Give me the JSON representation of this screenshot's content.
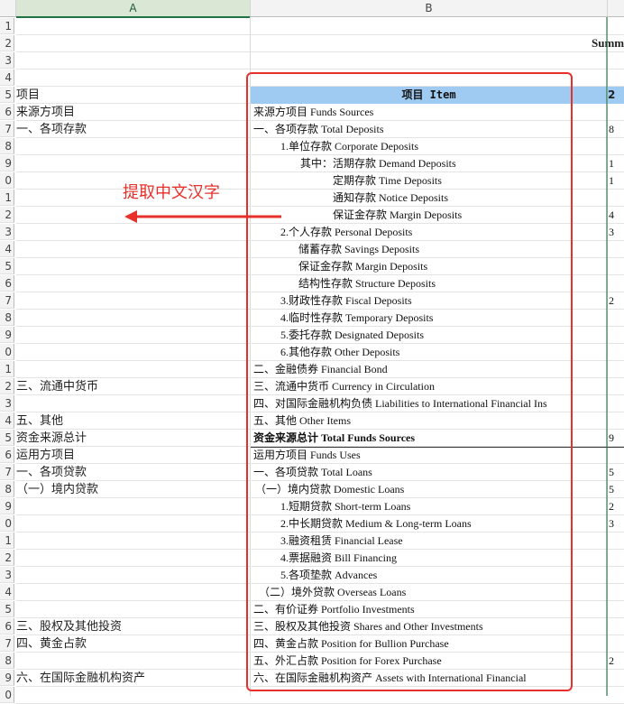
{
  "columns": {
    "a": "A",
    "b": "B"
  },
  "row_numbers": [
    "1",
    "2",
    "3",
    "4",
    "5",
    "6",
    "7",
    "8",
    "9",
    "0",
    "1",
    "2",
    "3",
    "4",
    "5",
    "6",
    "7",
    "8",
    "9",
    "0",
    "1",
    "2",
    "3",
    "4",
    "5",
    "6",
    "7",
    "8",
    "9",
    "0",
    "1",
    "2",
    "3",
    "4",
    "5",
    "6",
    "7",
    "8",
    "9",
    "0"
  ],
  "summary_label": "Summ",
  "annotation": "提取中文汉字",
  "header_row": {
    "a": "项目",
    "b": "项目 Item",
    "c": "2"
  },
  "rows": [
    {
      "a": "来源方项目",
      "b": "来源方项目 Funds Sources",
      "c": ""
    },
    {
      "a": "一、各项存款",
      "b": "一、各项存款 Total Deposits",
      "c": "8"
    },
    {
      "a": "",
      "b": "1.单位存款 Corporate Deposits",
      "c": ""
    },
    {
      "a": "",
      "b": "其中：活期存款 Demand Deposits",
      "c": "1"
    },
    {
      "a": "",
      "b": "定期存款 Time Deposits",
      "c": "1"
    },
    {
      "a": "",
      "b": "通知存款 Notice Deposits",
      "c": ""
    },
    {
      "a": "",
      "b": "保证金存款 Margin Deposits",
      "c": "4"
    },
    {
      "a": "",
      "b": "2.个人存款  Personal Deposits",
      "c": "3"
    },
    {
      "a": "",
      "b": "储蓄存款 Savings Deposits",
      "c": ""
    },
    {
      "a": "",
      "b": "保证金存款 Margin Deposits",
      "c": ""
    },
    {
      "a": "",
      "b": "结构性存款 Structure Deposits",
      "c": ""
    },
    {
      "a": "",
      "b": "3.财政性存款 Fiscal Deposits",
      "c": "2"
    },
    {
      "a": "",
      "b": "4.临时性存款 Temporary Deposits",
      "c": ""
    },
    {
      "a": "",
      "b": "5.委托存款 Designated  Deposits",
      "c": ""
    },
    {
      "a": "",
      "b": "6.其他存款 Other Deposits",
      "c": ""
    },
    {
      "a": "",
      "b": "二、金融债券 Financial Bond",
      "c": ""
    },
    {
      "a": "三、流通中货币",
      "b": "三、流通中货币 Currency in Circulation",
      "c": ""
    },
    {
      "a": "",
      "b": "四、对国际金融机构负债 Liabilities to International Financial Ins",
      "c": ""
    },
    {
      "a": "五、其他",
      "b": "五、其他  Other Items",
      "c": ""
    },
    {
      "a": "资金来源总计",
      "b": "资金来源总计 Total Funds Sources",
      "c": "9"
    },
    {
      "a": "运用方项目",
      "b": "运用方项目 Funds Uses",
      "c": ""
    },
    {
      "a": "一、各项贷款",
      "b": "一、各项贷款 Total Loans",
      "c": "5"
    },
    {
      "a": "（一）境内贷款",
      "b": "（一）境内贷款 Domestic Loans",
      "c": "5"
    },
    {
      "a": "",
      "b": "1.短期贷款 Short-term Loans",
      "c": "2"
    },
    {
      "a": "",
      "b": "2.中长期贷款 Medium & Long-term Loans",
      "c": "3"
    },
    {
      "a": "",
      "b": "3.融资租赁 Financial Lease",
      "c": ""
    },
    {
      "a": "",
      "b": "4.票据融资 Bill Financing",
      "c": ""
    },
    {
      "a": "",
      "b": "5.各项垫款 Advances",
      "c": ""
    },
    {
      "a": "",
      "b": "（二）境外贷款 Overseas Loans",
      "c": ""
    },
    {
      "a": "",
      "b": "二、有价证券 Portfolio Investments",
      "c": ""
    },
    {
      "a": "三、股权及其他投资",
      "b": "三、股权及其他投资 Shares and Other Investments",
      "c": ""
    },
    {
      "a": "四、黄金占款",
      "b": "四、黄金占款 Position for Bullion Purchase",
      "c": ""
    },
    {
      "a": "",
      "b": "五、外汇占款 Position for Forex Purchase",
      "c": "2"
    },
    {
      "a": "六、在国际金融机构资产",
      "b": "六、在国际金融机构资产 Assets with International Financial",
      "c": ""
    }
  ]
}
